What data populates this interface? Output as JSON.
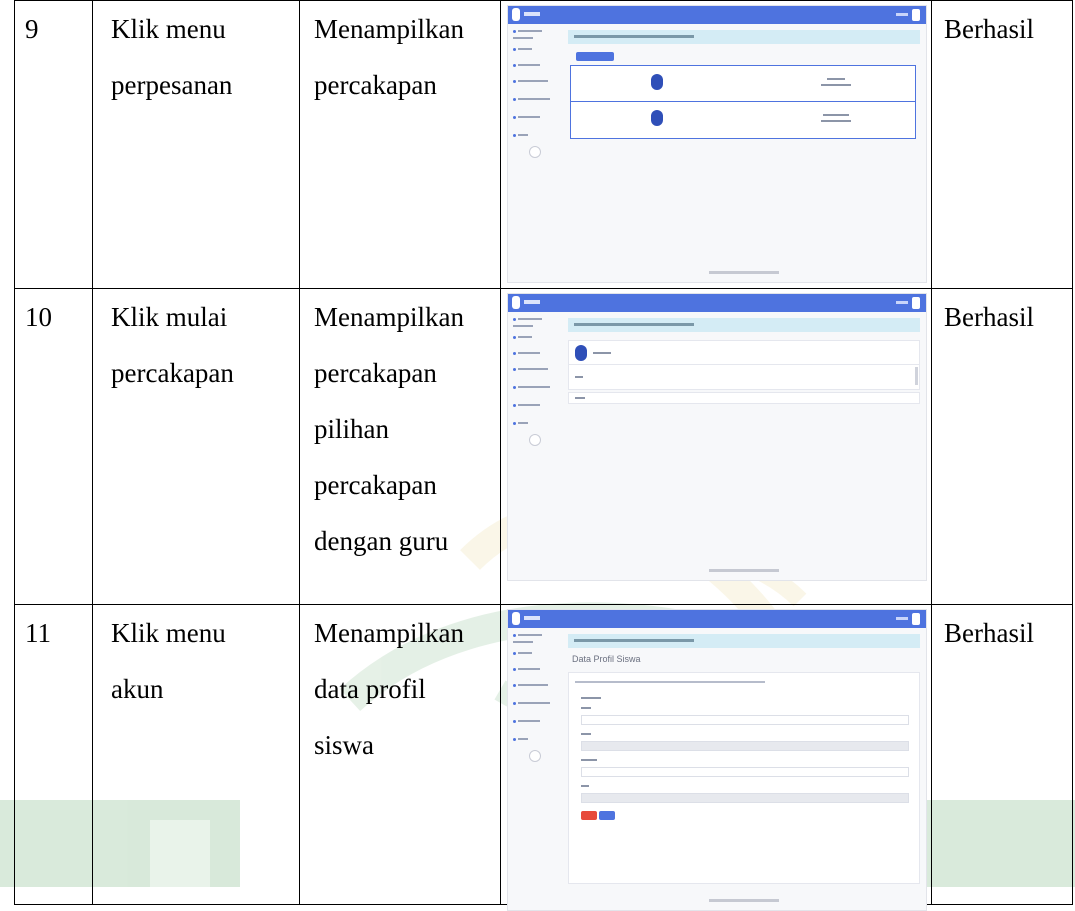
{
  "rows": [
    {
      "no": "9",
      "skenario": [
        "Klik menu",
        "perpesanan"
      ],
      "hasil": [
        "Menampilkan",
        "percakapan"
      ],
      "status": "Berhasil"
    },
    {
      "no": "10",
      "skenario": [
        "Klik mulai",
        "percakapan"
      ],
      "hasil": [
        "Menampilkan",
        "percakapan",
        "pilihan",
        "percakapan",
        "dengan guru"
      ],
      "status": "Berhasil"
    },
    {
      "no": "11",
      "skenario": [
        "Klik menu",
        "akun"
      ],
      "hasil": [
        "Menampilkan",
        "data profil",
        "siswa"
      ],
      "status": "Berhasil"
    }
  ],
  "screenshots": {
    "row11_title": "Data Profil Siswa"
  },
  "colors": {
    "navbar": "#4e73df",
    "banner": "#d4ecf5",
    "watermark_green": "#2e8b3a",
    "watermark_gold": "#d8b94a"
  }
}
